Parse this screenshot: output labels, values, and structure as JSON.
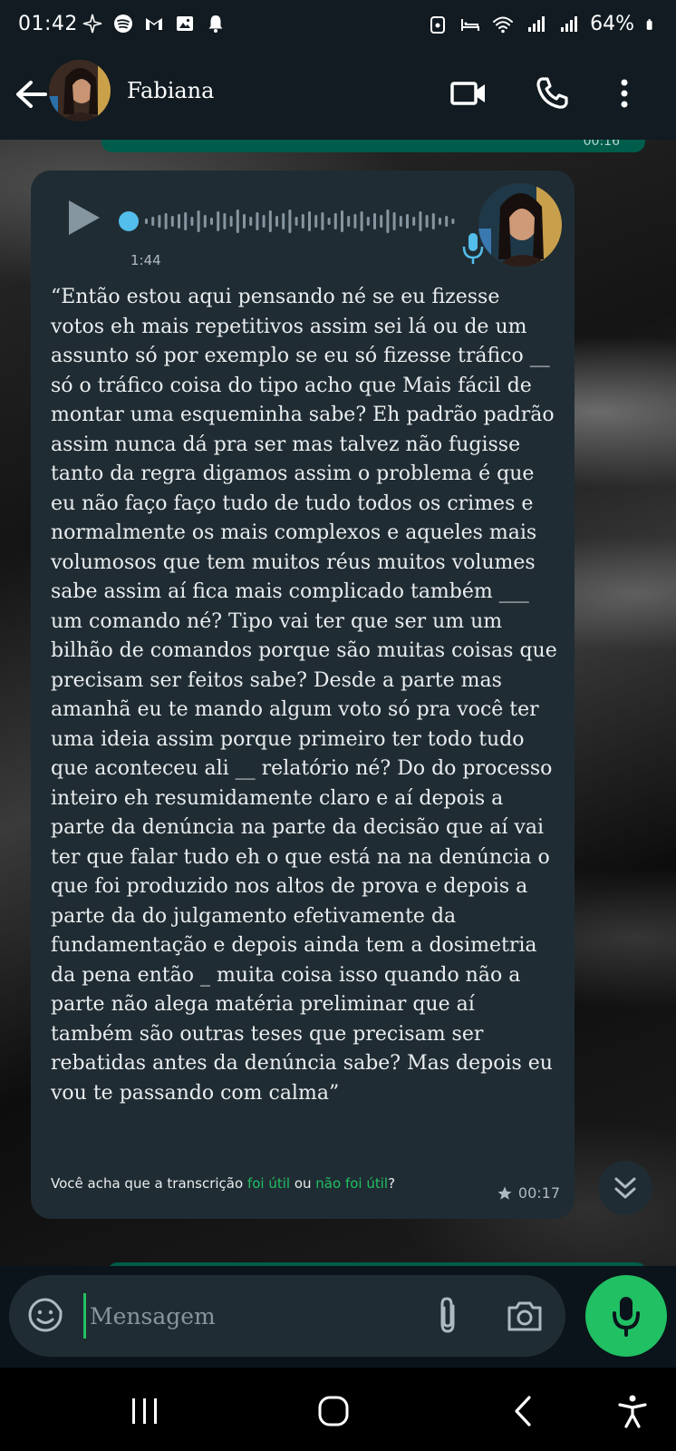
{
  "status_bar": {
    "time": "01:42",
    "battery": "64%",
    "left_icons": [
      "pinwheel-icon",
      "spotify-icon",
      "gmail-icon",
      "gallery-icon",
      "notification-bell-icon"
    ],
    "right_icons": [
      "lock-icon",
      "bed-icon",
      "wifi-icon",
      "signal-icon",
      "signal-icon",
      "battery-icon"
    ]
  },
  "header": {
    "contact_name": "Fabiana"
  },
  "message": {
    "duration": "1:44",
    "transcript": "“Então estou aqui pensando né se eu fizesse votos eh mais repetitivos assim sei lá ou de um assunto só por exemplo se eu só fizesse tráfico __ só o tráfico coisa do tipo acho que Mais fácil de montar uma esqueminha sabe? Eh padrão padrão assim nunca dá pra ser mas talvez não fugisse tanto da regra digamos assim o problema é que eu não faço faço tudo de tudo todos os crimes e normalmente os mais complexos e aqueles mais volumosos que tem muitos réus muitos volumes sabe assim aí fica mais complicado também ___ um comando né? Tipo vai ter que ser um um bilhão de comandos porque são muitas coisas que precisam ser feitos sabe? Desde a parte mas amanhã eu te mando algum voto só pra você ter uma ideia assim porque primeiro ter todo tudo que aconteceu ali __ relatório né? Do do processo inteiro eh resumidamente claro e aí depois a parte da denúncia na parte da decisão que aí vai ter que falar tudo eh o que está na na denúncia o que foi produzido nos altos de prova e depois a parte da do julgamento efetivamente da fundamentação e depois ainda tem a dosimetria da pena então _ muita coisa isso quando não a parte não alega matéria preliminar que aí também são outras teses que precisam ser rebatidas antes da denúncia sabe? Mas depois eu vou te passando com calma”",
    "feedback_prefix": "Você acha que a transcrição ",
    "feedback_useful": "foi útil",
    "feedback_or": " ou ",
    "feedback_not_useful": "não foi útil",
    "feedback_suffix": "?",
    "time": "00:17",
    "starred": true
  },
  "previous_message": {
    "time": "00:16"
  },
  "composer": {
    "placeholder": "Mensagem"
  },
  "colors": {
    "accent": "#21c063",
    "bubble_incoming": "#202c33",
    "bubble_outgoing": "#005c4b",
    "header_bg": "#111b21"
  }
}
